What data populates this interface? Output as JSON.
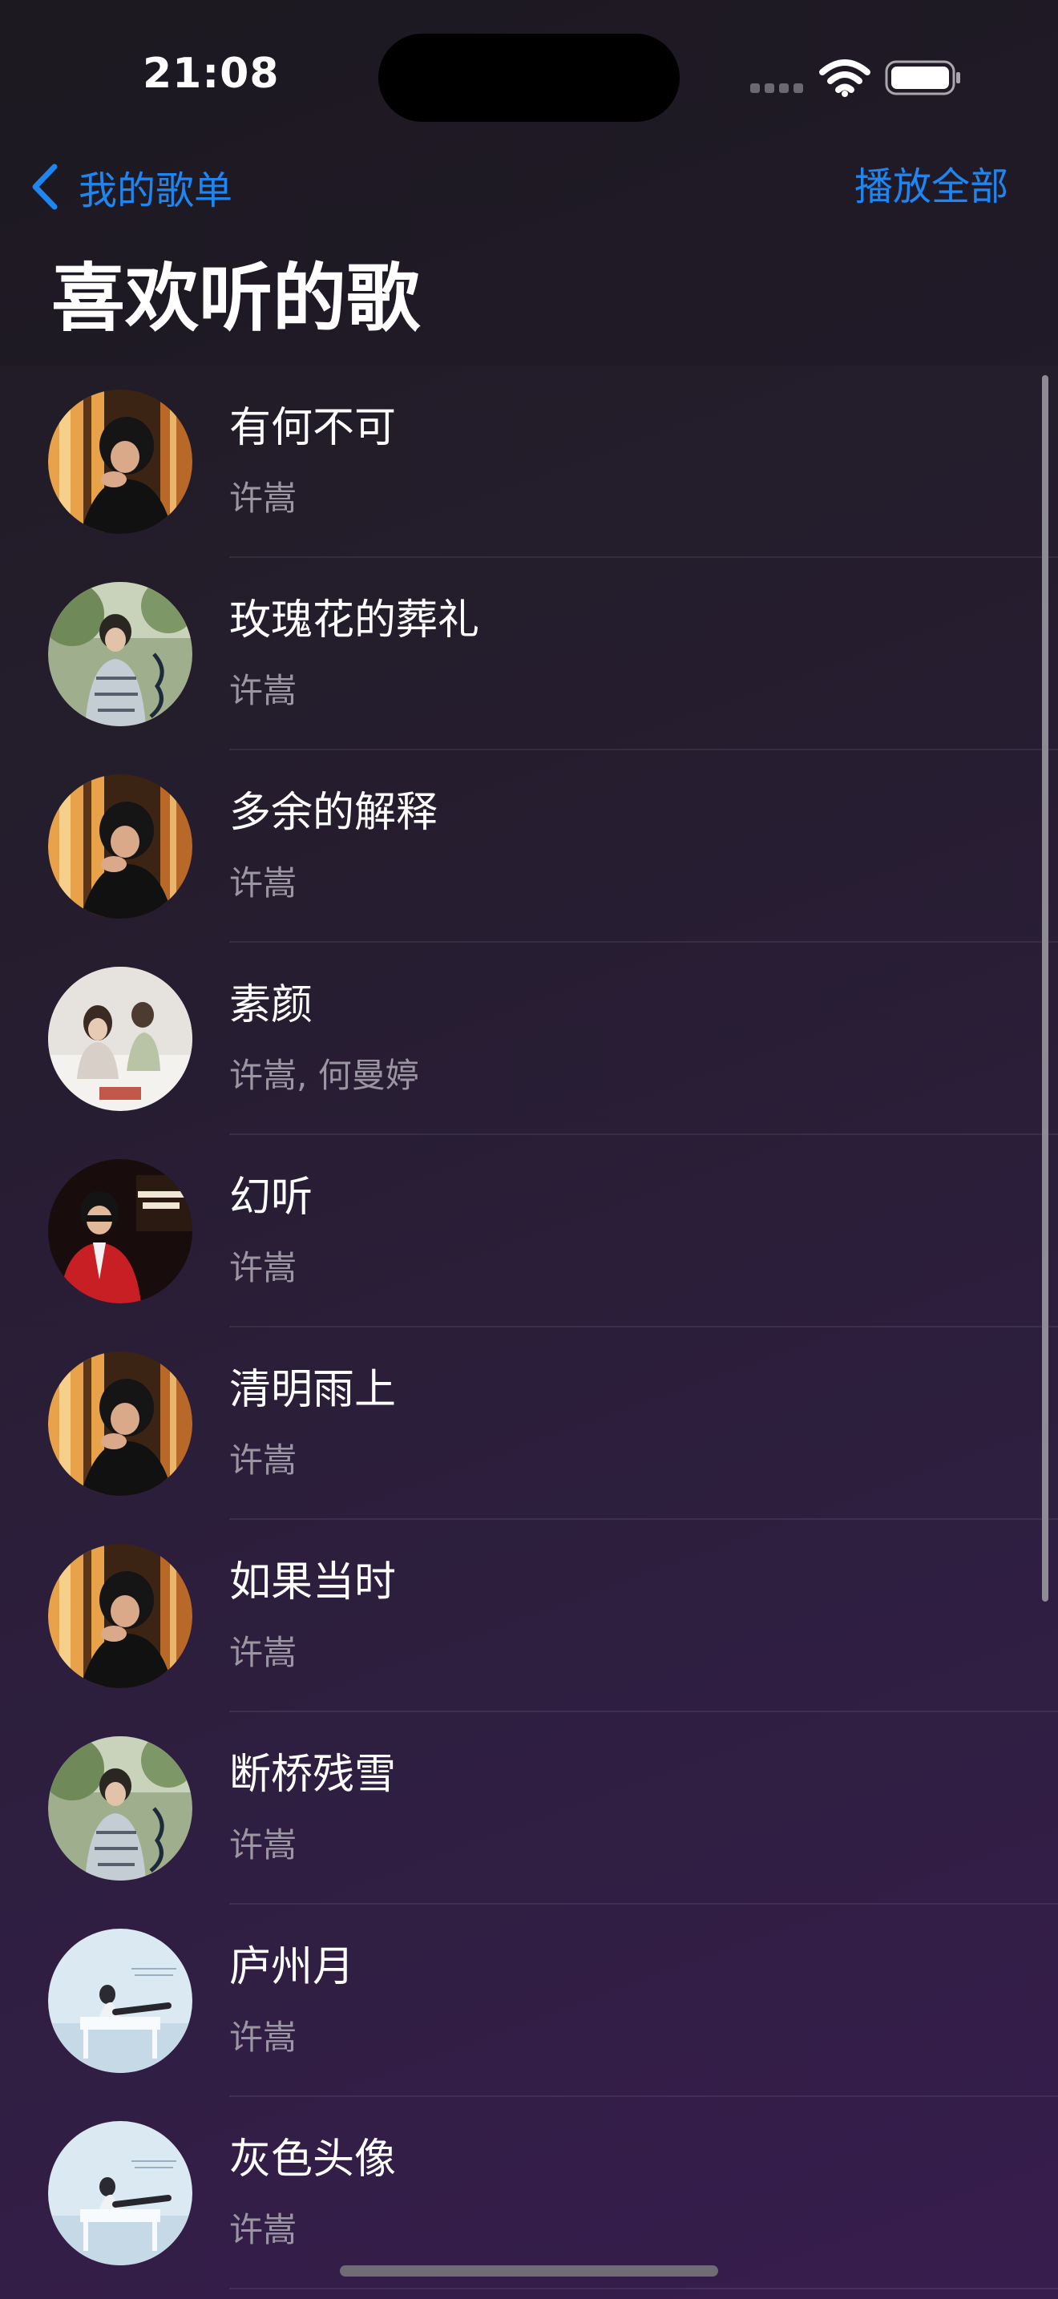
{
  "status_bar": {
    "time": "21:08",
    "icons": [
      "cellular-icon",
      "wifi-icon",
      "battery-icon"
    ]
  },
  "nav": {
    "back_label": "我的歌单",
    "play_all_label": "播放全部",
    "accent_color": "#1e86f0"
  },
  "page": {
    "title": "喜欢听的歌"
  },
  "songs": [
    {
      "title": "有何不可",
      "artist": "许嵩",
      "cover": "warm-portrait"
    },
    {
      "title": "玫瑰花的葬礼",
      "artist": "许嵩",
      "cover": "green-outdoor"
    },
    {
      "title": "多余的解释",
      "artist": "许嵩",
      "cover": "warm-portrait"
    },
    {
      "title": "素颜",
      "artist": "许嵩, 何曼婷",
      "cover": "white-duet"
    },
    {
      "title": "幻听",
      "artist": "许嵩",
      "cover": "red-stage"
    },
    {
      "title": "清明雨上",
      "artist": "许嵩",
      "cover": "warm-portrait"
    },
    {
      "title": "如果当时",
      "artist": "许嵩",
      "cover": "warm-portrait"
    },
    {
      "title": "断桥残雪",
      "artist": "许嵩",
      "cover": "green-outdoor"
    },
    {
      "title": "庐州月",
      "artist": "许嵩",
      "cover": "blue-piano"
    },
    {
      "title": "灰色头像",
      "artist": "许嵩",
      "cover": "blue-piano"
    }
  ]
}
